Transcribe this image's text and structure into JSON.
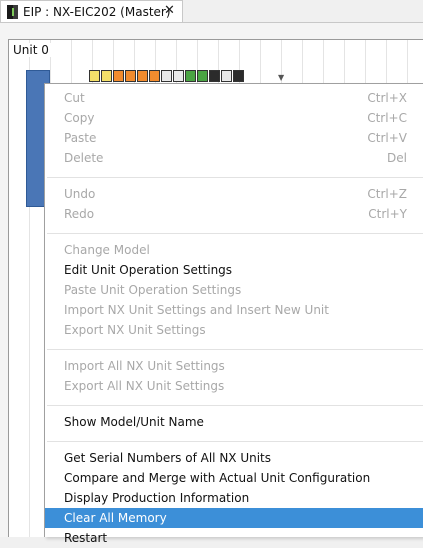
{
  "tab": {
    "title": "EIP : NX-EIC202 (Master)",
    "close": "✕"
  },
  "panel": {
    "unit_label": "Unit 0"
  },
  "modules": [
    {
      "color": "#f4e06a"
    },
    {
      "color": "#f4e06a"
    },
    {
      "color": "#f28c2e"
    },
    {
      "color": "#f28c2e"
    },
    {
      "color": "#f28c2e"
    },
    {
      "color": "#f28c2e"
    },
    {
      "color": "#e9e9e9"
    },
    {
      "color": "#e9e9e9"
    },
    {
      "color": "#4aa443"
    },
    {
      "color": "#4aa443"
    },
    {
      "color": "#2b2b2b"
    },
    {
      "color": "#e9e9e9"
    },
    {
      "color": "#2b2b2b"
    }
  ],
  "menu": {
    "items": [
      {
        "label": "Cut",
        "shortcut": "Ctrl+X",
        "enabled": false
      },
      {
        "label": "Copy",
        "shortcut": "Ctrl+C",
        "enabled": false
      },
      {
        "label": "Paste",
        "shortcut": "Ctrl+V",
        "enabled": false
      },
      {
        "label": "Delete",
        "shortcut": "Del",
        "enabled": false
      },
      {
        "label": "Undo",
        "shortcut": "Ctrl+Z",
        "enabled": false
      },
      {
        "label": "Redo",
        "shortcut": "Ctrl+Y",
        "enabled": false
      },
      {
        "label": "Change Model",
        "shortcut": "",
        "enabled": false
      },
      {
        "label": "Edit Unit Operation Settings",
        "shortcut": "",
        "enabled": true
      },
      {
        "label": "Paste Unit Operation Settings",
        "shortcut": "",
        "enabled": false
      },
      {
        "label": "Import NX Unit Settings and Insert New Unit",
        "shortcut": "",
        "enabled": false
      },
      {
        "label": "Export NX Unit Settings",
        "shortcut": "",
        "enabled": false
      },
      {
        "label": "Import All NX Unit Settings",
        "shortcut": "",
        "enabled": false
      },
      {
        "label": "Export All NX Unit Settings",
        "shortcut": "",
        "enabled": false
      },
      {
        "label": "Show Model/Unit Name",
        "shortcut": "",
        "enabled": true
      },
      {
        "label": "Get Serial Numbers of All NX Units",
        "shortcut": "",
        "enabled": true
      },
      {
        "label": "Compare and Merge with Actual Unit Configuration",
        "shortcut": "",
        "enabled": true
      },
      {
        "label": "Display Production Information",
        "shortcut": "",
        "enabled": true
      },
      {
        "label": "Clear All Memory",
        "shortcut": "",
        "enabled": true,
        "highlighted": true
      },
      {
        "label": "Restart",
        "shortcut": "",
        "enabled": true
      }
    ]
  }
}
